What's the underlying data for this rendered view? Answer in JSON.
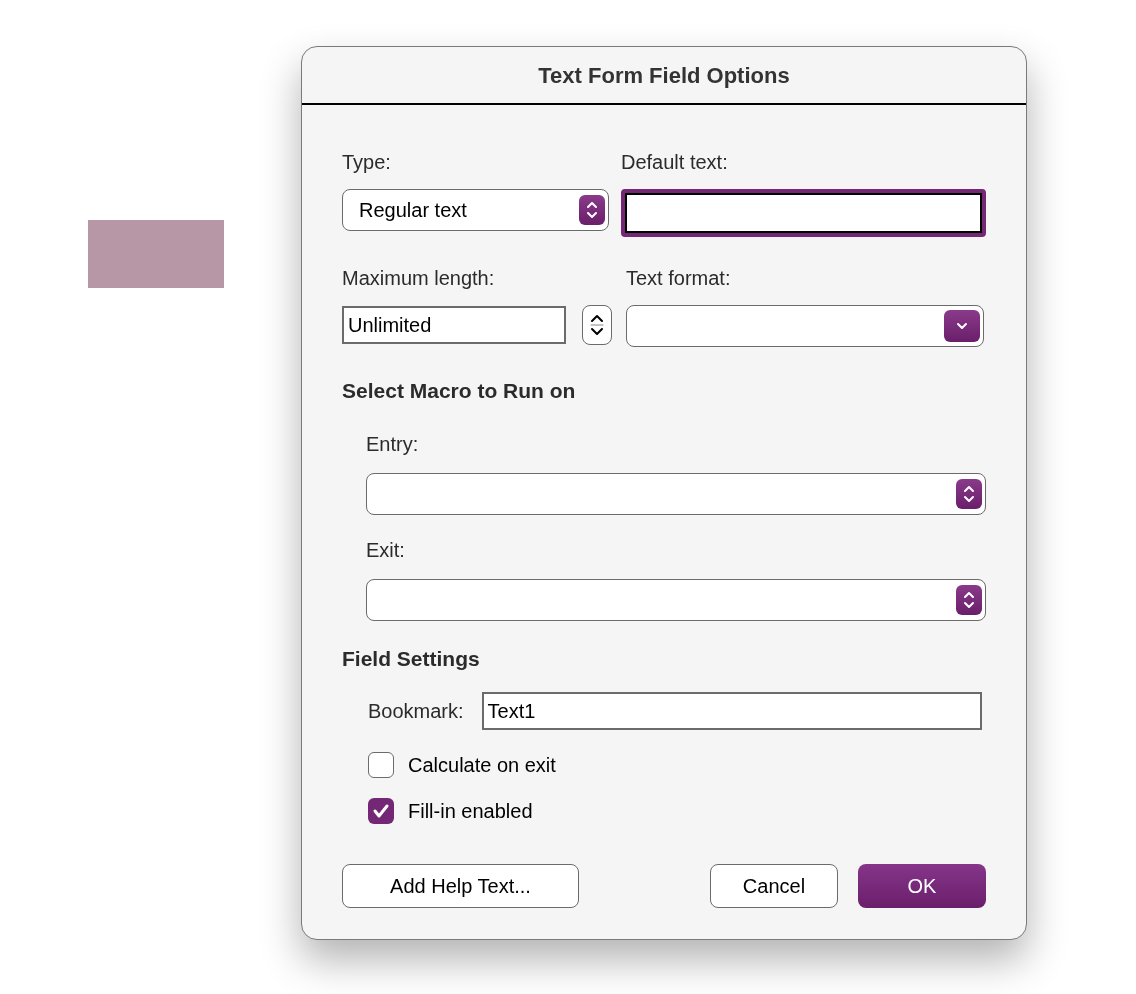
{
  "dialog": {
    "title": "Text Form Field Options"
  },
  "type": {
    "label": "Type:",
    "value": "Regular text"
  },
  "default_text": {
    "label": "Default text:",
    "focused": true
  },
  "maximum_length": {
    "label": "Maximum length:",
    "value": "Unlimited"
  },
  "text_format": {
    "label": "Text format:"
  },
  "macro": {
    "heading": "Select Macro to Run on",
    "entry": {
      "label": "Entry:"
    },
    "exit": {
      "label": "Exit:"
    }
  },
  "field_settings": {
    "heading": "Field Settings",
    "bookmark": {
      "label": "Bookmark:",
      "value": "Text1"
    },
    "options": [
      {
        "label": "Calculate on exit",
        "checked": false
      },
      {
        "label": "Fill-in enabled",
        "checked": true
      }
    ]
  },
  "help_button": {
    "label": "Add Help Text..."
  },
  "buttons": [
    {
      "label": "Cancel",
      "default": false
    },
    {
      "label": "OK",
      "default": true
    }
  ]
}
